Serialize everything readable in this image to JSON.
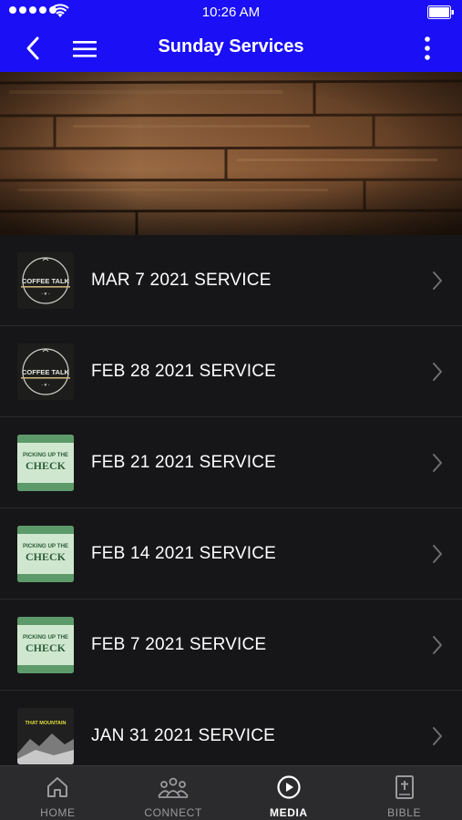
{
  "status_bar": {
    "time": "10:26 AM"
  },
  "nav": {
    "title": "Sunday Services"
  },
  "services": [
    {
      "title": "MAR 7 2021 SERVICE",
      "thumb": "coffee-talk",
      "thumb_text": "COFFEE TALK"
    },
    {
      "title": "FEB 28 2021 SERVICE",
      "thumb": "coffee-talk",
      "thumb_text": "COFFEE TALK"
    },
    {
      "title": "FEB 21 2021 SERVICE",
      "thumb": "picking-up-the-check",
      "thumb_text": "PICKING UP THE",
      "thumb_text2": "CHECK"
    },
    {
      "title": "FEB 14 2021 SERVICE",
      "thumb": "picking-up-the-check",
      "thumb_text": "PICKING UP THE",
      "thumb_text2": "CHECK"
    },
    {
      "title": "FEB 7 2021 SERVICE",
      "thumb": "picking-up-the-check",
      "thumb_text": "PICKING UP THE",
      "thumb_text2": "CHECK"
    },
    {
      "title": "JAN 31 2021 SERVICE",
      "thumb": "mountain",
      "thumb_text": "THAT MOUNTAIN"
    }
  ],
  "tabs": [
    {
      "label": "HOME",
      "icon": "home-icon",
      "active": false
    },
    {
      "label": "CONNECT",
      "icon": "people-icon",
      "active": false
    },
    {
      "label": "MEDIA",
      "icon": "play-circle-icon",
      "active": true
    },
    {
      "label": "BIBLE",
      "icon": "bible-icon",
      "active": false
    }
  ],
  "colors": {
    "nav_bg": "#1a0ff5",
    "list_bg": "#161618",
    "tabbar_bg": "#2b2b2d",
    "tab_inactive": "#9a9a9e"
  }
}
